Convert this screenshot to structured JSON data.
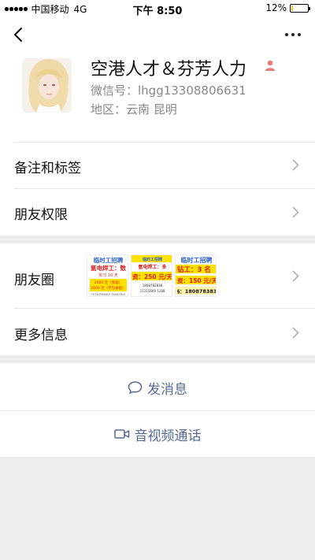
{
  "status_bar": {
    "carrier": "中国移动",
    "network": "4G",
    "time": "下午 8:50",
    "battery_text": "12%",
    "battery_level": 0.12,
    "battery_color": "#f0c417"
  },
  "navbar": {
    "back_icon": "chevron-left-icon",
    "more_icon": "ellipsis-icon"
  },
  "profile": {
    "name": "空港人才＆芬芳人力",
    "wechat_id": "微信号：lhgg13308806631",
    "region": "地区：云南 昆明",
    "gender_icon": "female-icon",
    "gender_color": "#e87a7a"
  },
  "menu": {
    "remarks_tags": "备注和标签",
    "friend_permissions": "朋友权限",
    "moments": "朋友圈",
    "more_info": "更多信息"
  },
  "moments_thumbs": [
    {
      "headline": "临时工招聘",
      "line1": "氩电焊工：数",
      "line2": "实习 10 天",
      "line3": "2000 元（食宿）",
      "line4": "2600 元（不包食宿）",
      "line5": "15787996852 18087810"
    },
    {
      "headline": "临时工招聘",
      "line1": "氩电焊工：多",
      "line2": "资：250 元/天",
      "line3": "1808782838",
      "line4": "15315669 1288"
    },
    {
      "headline": "临时工招聘",
      "line1": "钻工：3 名",
      "line2": "资：150 元/天",
      "line3": "§：180878383"
    }
  ],
  "actions": {
    "send_message": "发消息",
    "video_call": "音视频通话"
  },
  "colors": {
    "link_blue": "#576b95",
    "page_bg": "#ededed",
    "thumb_title_blue": "#2b62c9",
    "thumb_red": "#d81e1e",
    "thumb_yellow": "#ffe100"
  }
}
